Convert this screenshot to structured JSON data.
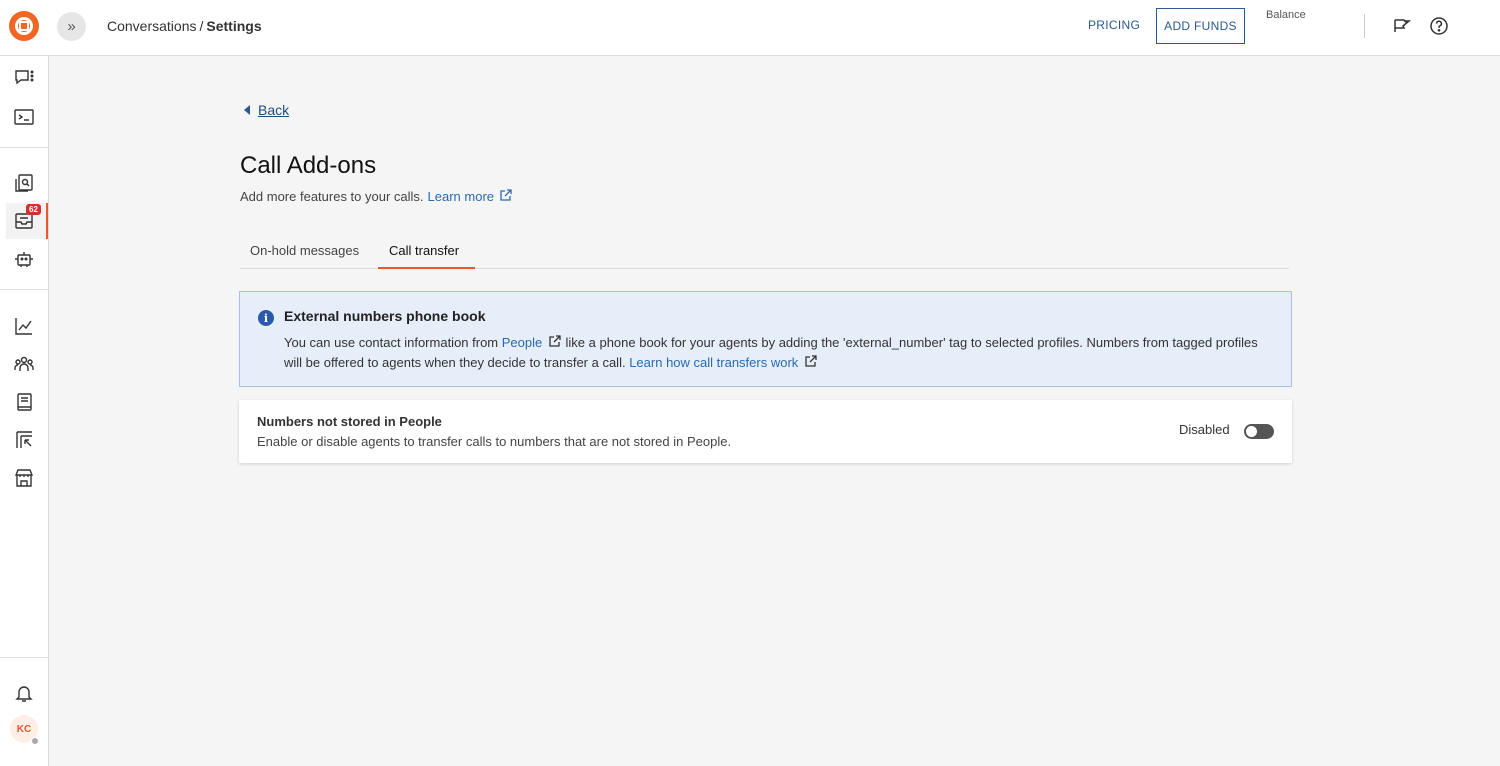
{
  "header": {
    "breadcrumb": {
      "parent": "Conversations",
      "separator": "/",
      "current": "Settings"
    },
    "pricing_label": "PRICING",
    "add_funds_label": "ADD FUNDS",
    "balance_label": "Balance"
  },
  "sidebar": {
    "badge_count": "62",
    "avatar_initials": "KC"
  },
  "main": {
    "back_label": "Back",
    "title": "Call Add-ons",
    "subtitle": "Add more features to your calls.",
    "learn_more": "Learn more",
    "tabs": [
      {
        "label": "On-hold messages",
        "active": false
      },
      {
        "label": "Call transfer",
        "active": true
      }
    ],
    "info": {
      "title": "External numbers phone book",
      "text_part1": "You can use contact information from",
      "people_link": "People",
      "text_part2": "like a phone book for your agents by adding the 'external_number' tag to selected profiles. Numbers from tagged profiles will be offered to agents when they decide to transfer a call.",
      "learn_link": "Learn how call transfers work"
    },
    "setting": {
      "title": "Numbers not stored in People",
      "description": "Enable or disable agents to transfer calls to numbers that are not stored in People.",
      "status": "Disabled",
      "enabled": false
    }
  },
  "colors": {
    "accent": "#e8582a",
    "link": "#2a6ab0",
    "info_bg": "#e6eefa"
  }
}
